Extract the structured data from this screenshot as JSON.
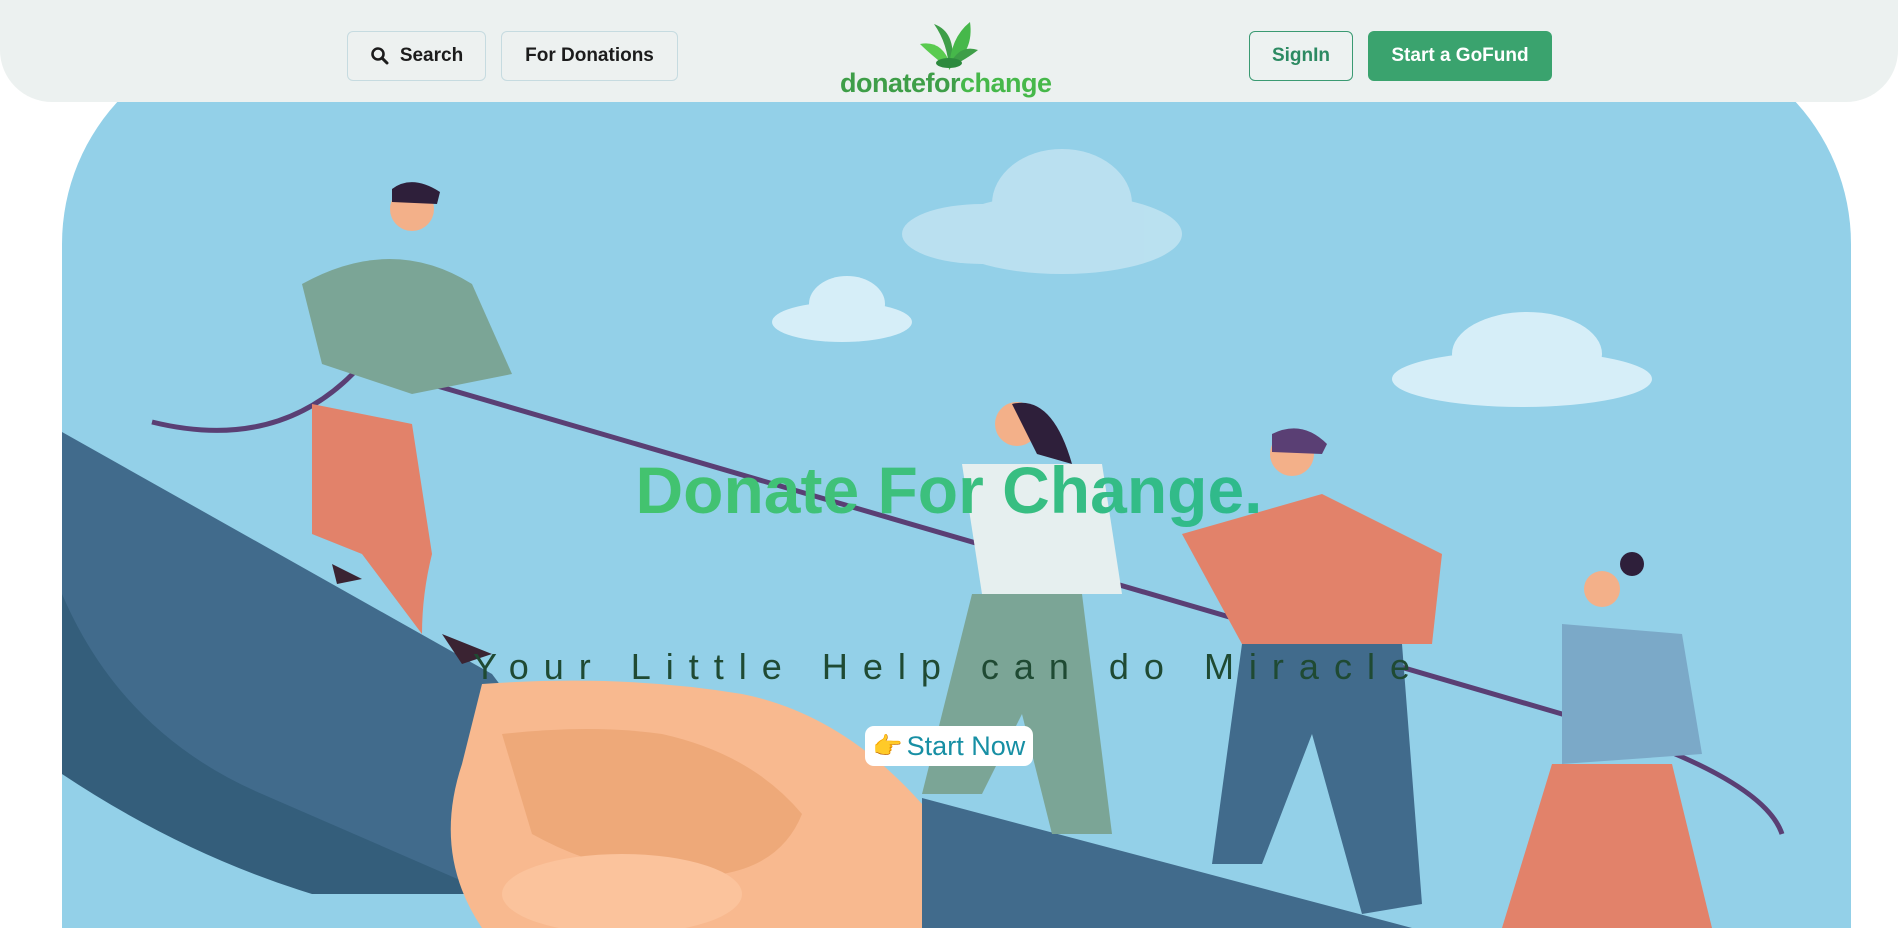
{
  "navbar": {
    "search_label": "Search",
    "donations_label": "For Donations",
    "signin_label": "SignIn",
    "gofund_label": "Start a GoFund",
    "logo_text_main": "donatefor",
    "logo_text_accent": "change"
  },
  "hero": {
    "title": "Donate For Change.",
    "subtitle": "Your Little Help can do Miracle",
    "cta_emoji": "👉",
    "cta_label": "Start Now"
  },
  "icons": {
    "search": "search-icon",
    "logo_leaf": "leaf-icon",
    "cta_pointer": "pointing-hand-icon"
  },
  "colors": {
    "brand_green": "#3aa36e",
    "logo_green": "#3e9e48",
    "sky": "#93d0e8",
    "title_gradient_start": "#4fc94c",
    "title_gradient_end": "#13aeaa",
    "cta_text": "#178fa4"
  }
}
